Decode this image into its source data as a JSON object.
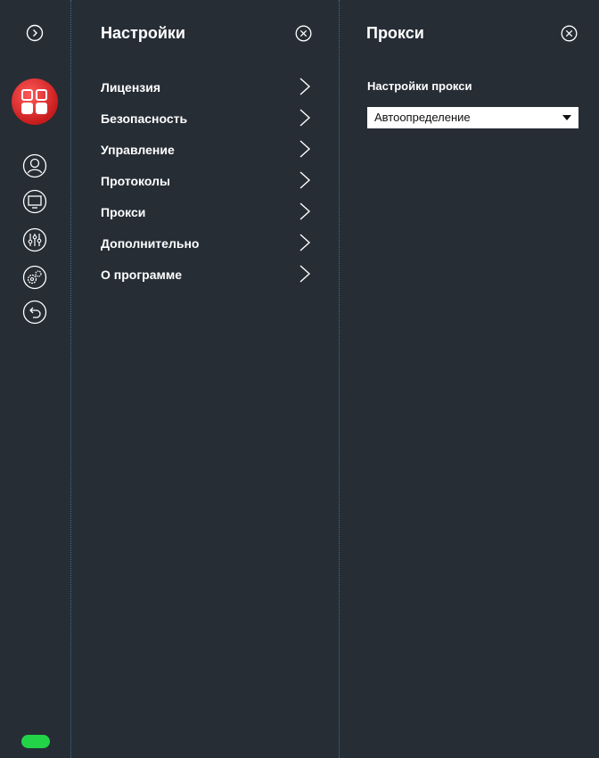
{
  "rail": {
    "icons": [
      "expand-icon",
      "app-logo",
      "user-icon",
      "monitor-icon",
      "equalizer-icon",
      "gears-icon",
      "undo-icon"
    ],
    "status_color": "#22d348",
    "logo_color": "#d92b2b"
  },
  "settings_panel": {
    "title": "Настройки",
    "items": [
      {
        "label": "Лицензия"
      },
      {
        "label": "Безопасность"
      },
      {
        "label": "Управление"
      },
      {
        "label": "Протоколы"
      },
      {
        "label": "Прокси"
      },
      {
        "label": "Дополнительно"
      },
      {
        "label": "О программе"
      }
    ]
  },
  "proxy_panel": {
    "title": "Прокси",
    "section_label": "Настройки прокси",
    "select_value": "Автоопределение"
  },
  "colors": {
    "background": "#262d35",
    "divider": "#3f6f93",
    "text": "#ffffff"
  }
}
